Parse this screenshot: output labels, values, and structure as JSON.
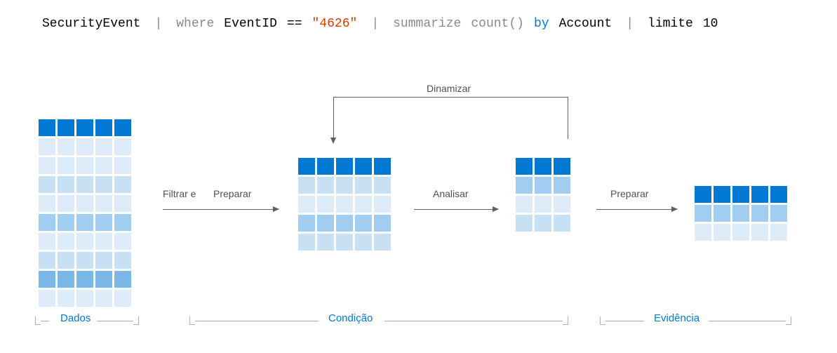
{
  "query": {
    "table": "SecurityEvent",
    "where_kw": "where",
    "where_field": "EventID",
    "where_op": "==",
    "where_val": "\"4626\"",
    "summarize_kw": "summarize",
    "summarize_fn": "count()",
    "by_kw": "by",
    "by_field": "Account",
    "limit_kw": "limite",
    "limit_val": "10"
  },
  "arrows": {
    "filter": "Filtrar e",
    "prepare": "Preparar",
    "analyze": "Analisar",
    "prepare2": "Preparar",
    "pivot": "Dinamizar"
  },
  "sections": {
    "data": "Dados",
    "condition": "Condição",
    "evidence": "Evidência"
  },
  "grids": {
    "dados": {
      "cols": 5,
      "rows": [
        "hdr",
        "1",
        "1",
        "2",
        "1",
        "3",
        "1",
        "2",
        "4",
        "1"
      ]
    },
    "cond1": {
      "cols": 5,
      "rows": [
        "hdr",
        "2",
        "1",
        "3",
        "2"
      ]
    },
    "cond2": {
      "cols": 3,
      "rows": [
        "hdr",
        "3",
        "1",
        "2"
      ]
    },
    "evid": {
      "cols": 5,
      "rows": [
        "hdr",
        "3",
        "1"
      ]
    }
  },
  "colors": {
    "header": "#0078d4",
    "shade1": "#deecf9",
    "shade2": "#c7e0f4",
    "shade3": "#a1cdf1",
    "shade4": "#7bb8e8",
    "accent_red": "#d83b01",
    "accent_blue": "#0078d4"
  }
}
